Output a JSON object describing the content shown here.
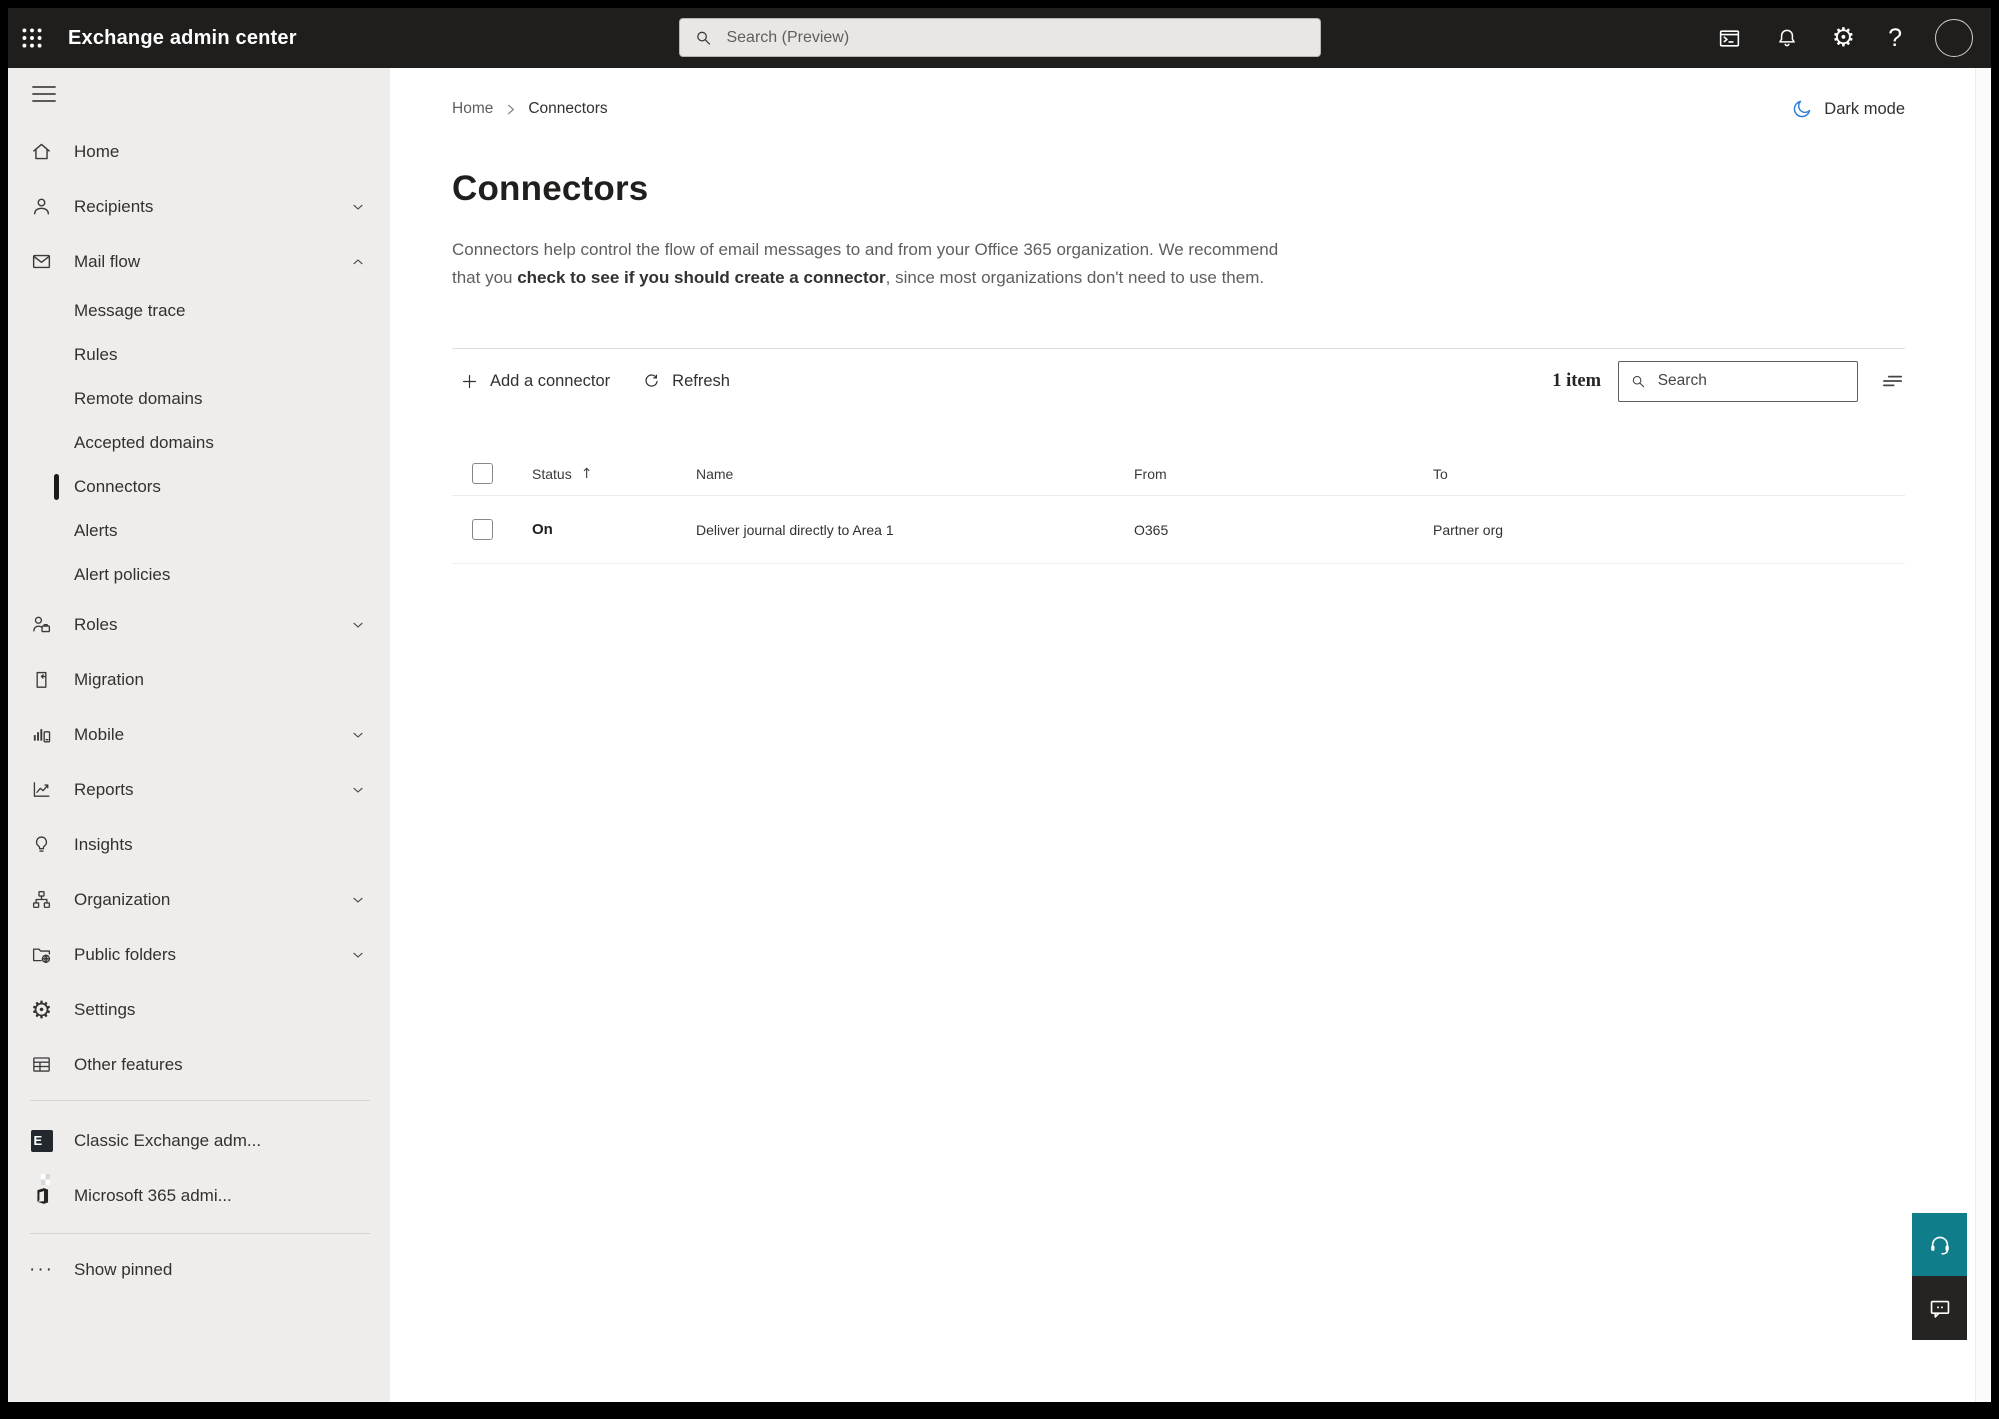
{
  "topbar": {
    "app_title": "Exchange admin center",
    "search_placeholder": "Search (Preview)"
  },
  "header": {
    "breadcrumb": {
      "home": "Home",
      "current": "Connectors"
    },
    "dark_mode_label": "Dark mode"
  },
  "sidebar": {
    "items": [
      {
        "label": "Home"
      },
      {
        "label": "Recipients"
      },
      {
        "label": "Mail flow"
      },
      {
        "label": "Message trace"
      },
      {
        "label": "Rules"
      },
      {
        "label": "Remote domains"
      },
      {
        "label": "Accepted domains"
      },
      {
        "label": "Connectors"
      },
      {
        "label": "Alerts"
      },
      {
        "label": "Alert policies"
      },
      {
        "label": "Roles"
      },
      {
        "label": "Migration"
      },
      {
        "label": "Mobile"
      },
      {
        "label": "Reports"
      },
      {
        "label": "Insights"
      },
      {
        "label": "Organization"
      },
      {
        "label": "Public folders"
      },
      {
        "label": "Settings"
      },
      {
        "label": "Other features"
      },
      {
        "label": "Classic Exchange adm..."
      },
      {
        "label": "Microsoft 365 admi..."
      },
      {
        "label": "Show pinned"
      }
    ]
  },
  "page": {
    "title": "Connectors",
    "description_pre": "Connectors help control the flow of email messages to and from your Office 365 organization. We recommend that you ",
    "description_link": "check to see if you should create a connector",
    "description_post": ", since most organizations don't need to use them."
  },
  "toolbar": {
    "add_label": "Add a connector",
    "refresh_label": "Refresh",
    "item_count": "1 item",
    "search_placeholder": "Search"
  },
  "table": {
    "headers": {
      "status": "Status",
      "name": "Name",
      "from": "From",
      "to": "To"
    },
    "sort_glyph": "↑",
    "rows": [
      {
        "status": "On",
        "name": "Deliver journal directly to Area 1",
        "from": "O365",
        "to": "Partner org"
      }
    ]
  },
  "icons": {
    "gear_glyph": "⚙",
    "help_glyph": "?",
    "show_pinned_glyph": "···",
    "classic_exchange_glyph": "E"
  },
  "colors": {
    "topbar_bg": "#1f1e1d",
    "sidebar_bg": "#efedec",
    "accent_blue": "#2f80d8",
    "support_teal": "#0f7e8a",
    "feedback_dark": "#252423"
  }
}
